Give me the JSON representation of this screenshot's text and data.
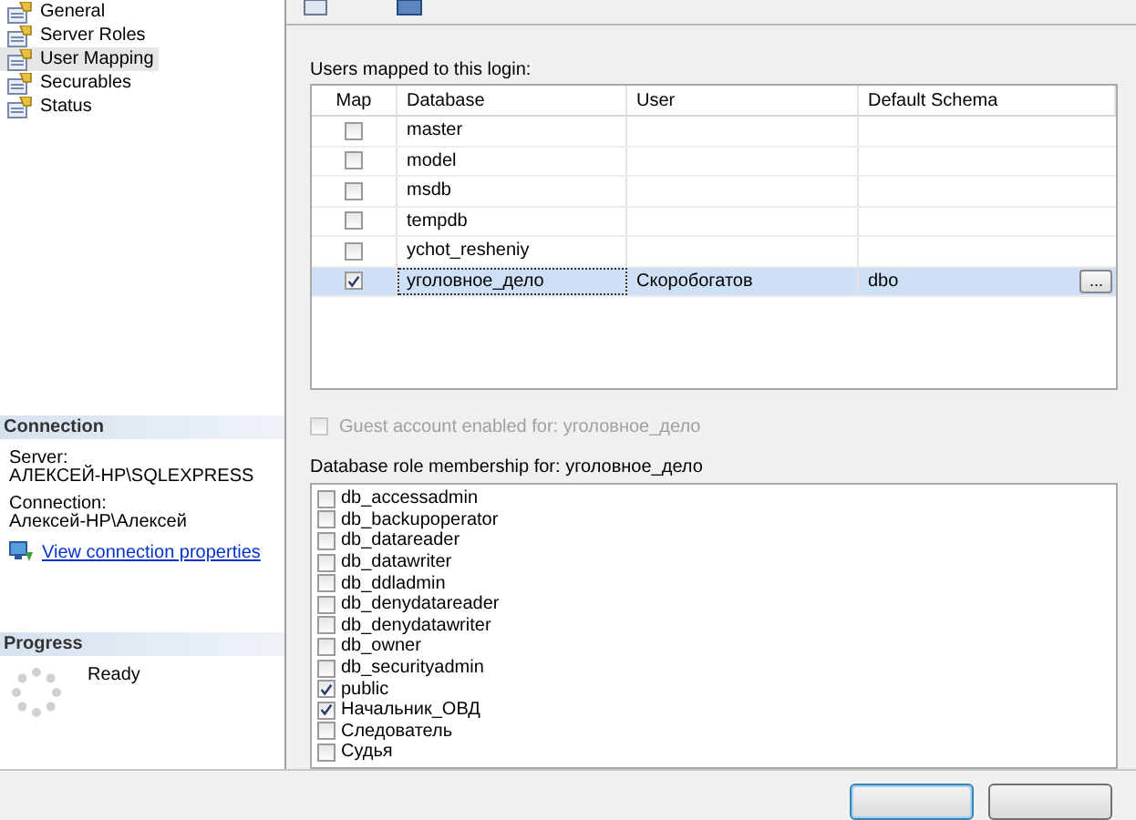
{
  "sidebar": {
    "pages": [
      {
        "label": "General",
        "selected": false
      },
      {
        "label": "Server Roles",
        "selected": false
      },
      {
        "label": "User Mapping",
        "selected": true
      },
      {
        "label": "Securables",
        "selected": false
      },
      {
        "label": "Status",
        "selected": false
      }
    ],
    "connection": {
      "title": "Connection",
      "server_label": "Server:",
      "server": "АЛЕКСЕЙ-HP\\SQLEXPRESS",
      "connection_label": "Connection:",
      "connection": "Алексей-HP\\Алексей",
      "link": "View connection properties"
    },
    "progress": {
      "title": "Progress",
      "status": "Ready"
    }
  },
  "users_mapped": {
    "label": "Users mapped to this login:",
    "columns": [
      "Map",
      "Database",
      "User",
      "Default Schema"
    ],
    "rows": [
      {
        "checked": false,
        "selected": false,
        "database": "master"
      },
      {
        "checked": false,
        "selected": false,
        "database": "model"
      },
      {
        "checked": false,
        "selected": false,
        "database": "msdb"
      },
      {
        "checked": false,
        "selected": false,
        "database": "tempdb"
      },
      {
        "checked": false,
        "selected": false,
        "database": "ychot_resheniy"
      },
      {
        "checked": true,
        "selected": true,
        "database": "уголовное_дело",
        "user": "Скоробогатов",
        "schema": "dbo",
        "action": "..."
      }
    ]
  },
  "guest": {
    "label": "Guest account enabled for: уголовное_дело",
    "checked": false,
    "disabled": true
  },
  "roles": {
    "label": "Database role membership for: уголовное_дело",
    "items": [
      {
        "label": "db_accessadmin",
        "checked": false
      },
      {
        "label": "db_backupoperator",
        "checked": false
      },
      {
        "label": "db_datareader",
        "checked": false
      },
      {
        "label": "db_datawriter",
        "checked": false
      },
      {
        "label": "db_ddladmin",
        "checked": false
      },
      {
        "label": "db_denydatareader",
        "checked": false
      },
      {
        "label": "db_denydatawriter",
        "checked": false
      },
      {
        "label": "db_owner",
        "checked": false
      },
      {
        "label": "db_securityadmin",
        "checked": false
      },
      {
        "label": "public",
        "checked": true
      },
      {
        "label": "Начальник_ОВД",
        "checked": true
      },
      {
        "label": "Следователь",
        "checked": false
      },
      {
        "label": "Судья",
        "checked": false
      }
    ]
  }
}
